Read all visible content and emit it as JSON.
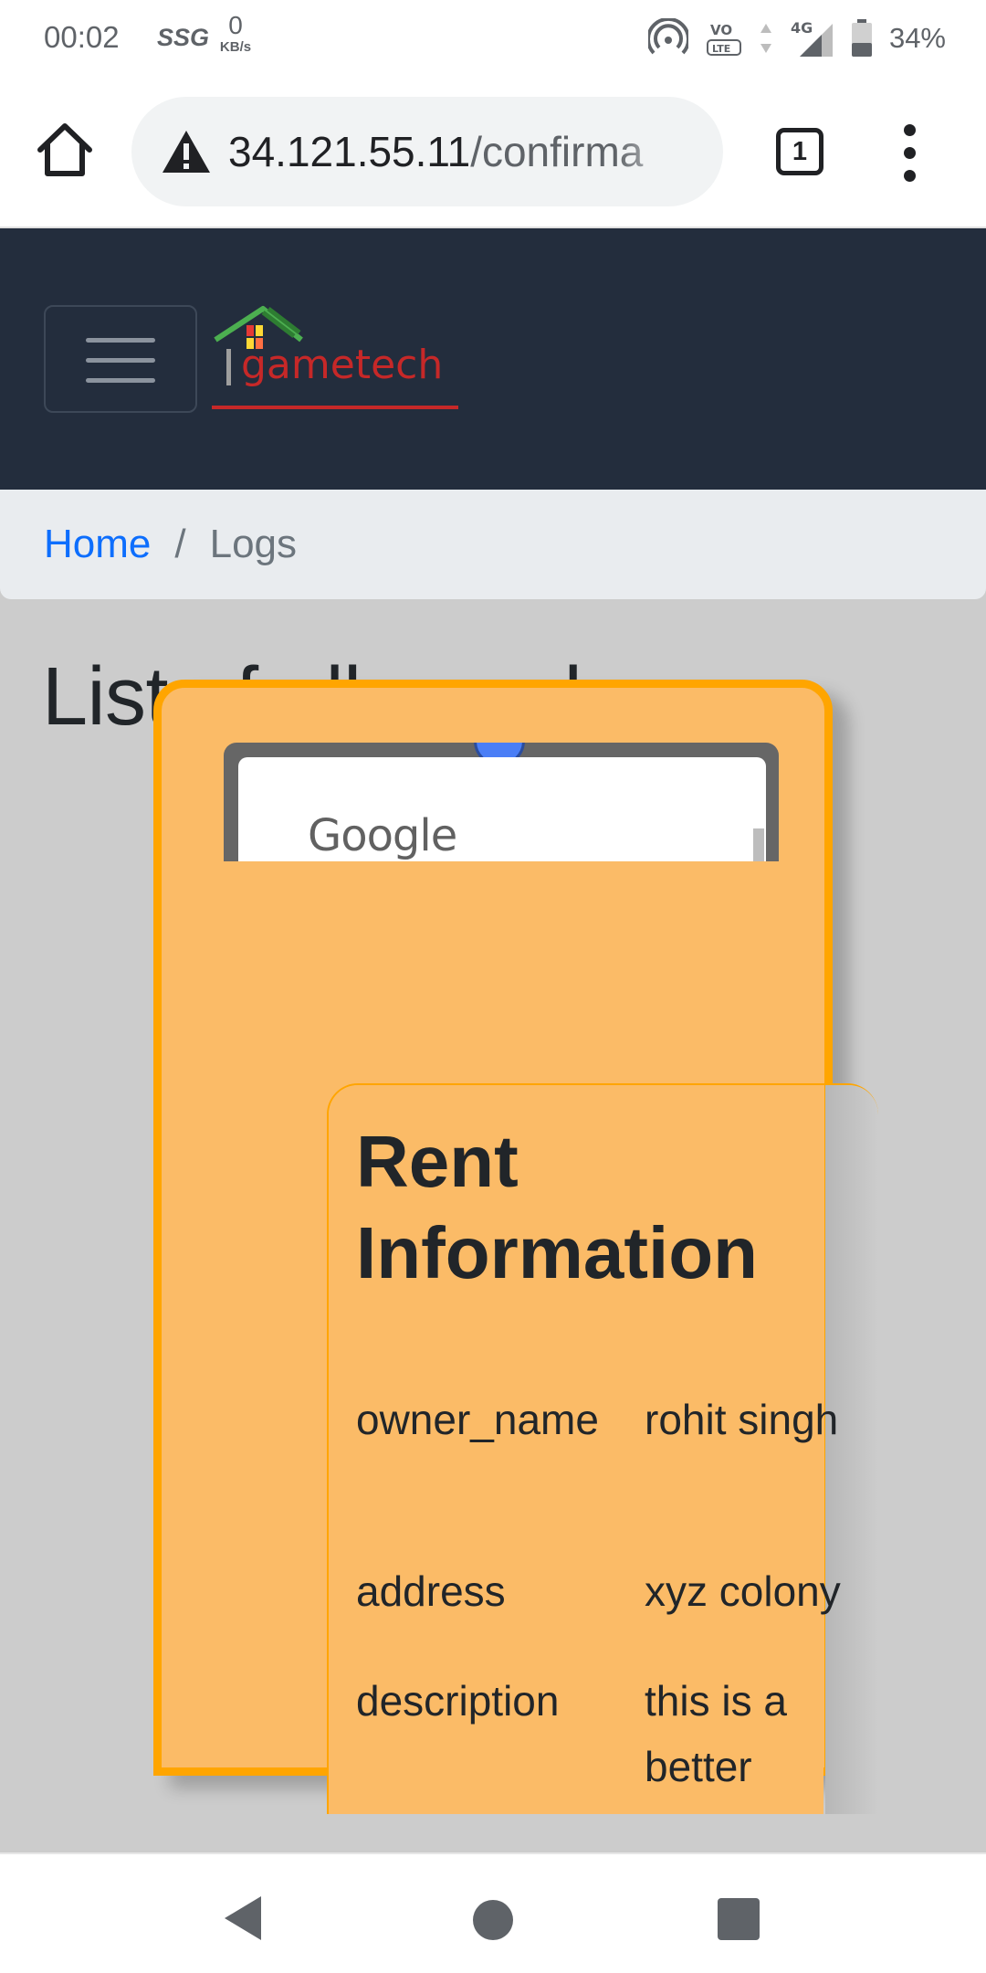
{
  "status_bar": {
    "time": "00:02",
    "carrier_glyph": "SSG",
    "speed_value": "0",
    "speed_unit": "KB/s",
    "battery_percent": "34%",
    "icons": [
      "hotspot-icon",
      "volte-icon",
      "data-arrows-icon",
      "signal-4g-icon",
      "battery-icon"
    ],
    "network_label": "4G"
  },
  "browser": {
    "url_host": "34.121.55.11",
    "url_path": "/confirma",
    "tab_count": "1",
    "icons": [
      "home-icon",
      "not-secure-warning-icon",
      "tabs-icon",
      "overflow-menu-icon"
    ]
  },
  "site": {
    "brand_text": "gametech",
    "breadcrumb": {
      "home": "Home",
      "separator": "/",
      "current": "Logs"
    },
    "page_title": "List of all your logs",
    "map": {
      "logo_text": "Google"
    },
    "rent_card": {
      "title": "Rent Information",
      "rows": [
        {
          "key": "owner_name",
          "value": "rohit singh"
        },
        {
          "key": "address",
          "value": "xyz colony"
        },
        {
          "key": "description",
          "value": "this is a better"
        }
      ]
    }
  },
  "colors": {
    "navbar_bg": "#232d3d",
    "breadcrumb_bg": "#e9ecef",
    "link": "#0d6efd",
    "page_bg": "#cccccc",
    "card_fill": "#fbbb67",
    "card_border": "#ffa500"
  }
}
